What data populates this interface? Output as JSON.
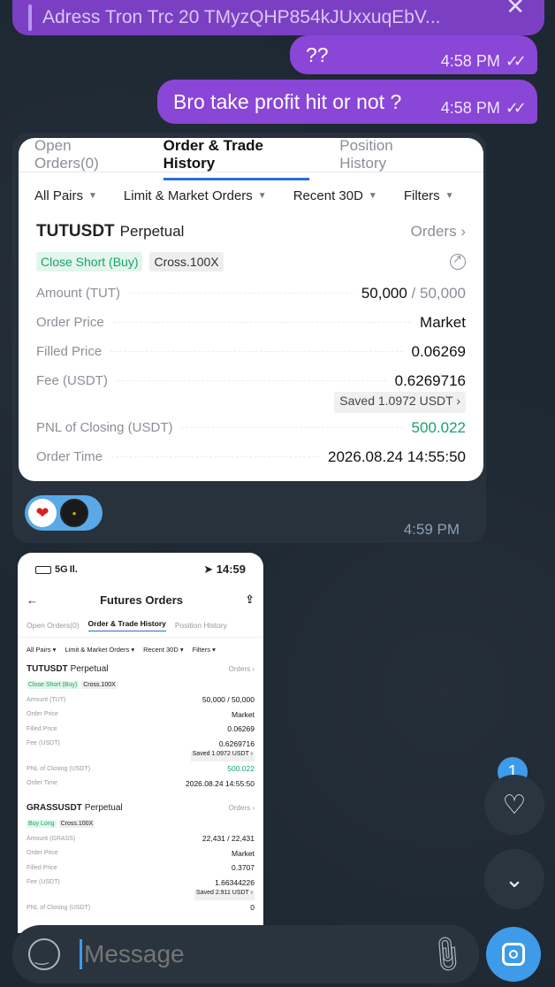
{
  "reply_preview": {
    "text": "Adress Tron Trc 20  TMyzQHP854kJUxxuqEbV...",
    "close": "✕"
  },
  "outgoing": [
    {
      "text": "??",
      "time": "4:58 PM"
    },
    {
      "text": "Bro take profit hit or not ?",
      "time": "4:58 PM"
    }
  ],
  "card": {
    "tabs": [
      "Open Orders(0)",
      "Order & Trade History",
      "Position History"
    ],
    "filters": [
      "All Pairs",
      "Limit & Market Orders",
      "Recent 30D",
      "Filters"
    ],
    "pair": "TUTUSDT",
    "pair_type": "Perpetual",
    "orders_link": "Orders",
    "badge_side": "Close Short (Buy)",
    "badge_margin": "Cross.100X",
    "rows": [
      {
        "label": "Amount (TUT)",
        "value": "50,000",
        "value2": " / 50,000"
      },
      {
        "label": "Order Price",
        "value": "Market"
      },
      {
        "label": "Filled Price",
        "value": "0.06269"
      },
      {
        "label": "Fee (USDT)",
        "value": "0.6269716"
      }
    ],
    "saved": "Saved 1.0972 USDT ›",
    "pnl_label": "PNL of Closing (USDT)",
    "pnl_value": "500.022",
    "time_label": "Order Time",
    "time_value": "2026.08.24 14:55:50"
  },
  "incoming_time": "4:59 PM",
  "shot": {
    "signal": "5G",
    "clock": "14:59",
    "title": "Futures Orders",
    "tabs": [
      "Open Orders(0)",
      "Order & Trade History",
      "Position History"
    ],
    "filters": [
      "All Pairs ▾",
      "Limit & Market Orders ▾",
      "Recent 30D ▾",
      "Filters ▾"
    ],
    "order1": {
      "pair": "TUTUSDT",
      "type": "Perpetual",
      "link": "Orders ›",
      "side": "Close Short (Buy)",
      "margin": "Cross.100X",
      "rows": [
        [
          "Amount (TUT)",
          "50,000 / 50,000"
        ],
        [
          "Order Price",
          "Market"
        ],
        [
          "Filled Price",
          "0.06269"
        ],
        [
          "Fee (USDT)",
          "0.6269716"
        ]
      ],
      "saved": "Saved 1.0972 USDT ›",
      "pnl": [
        "PNL of Closing (USDT)",
        "500.022"
      ],
      "time": [
        "Order Time",
        "2026.08.24 14:55:50"
      ]
    },
    "order2": {
      "pair": "GRASSUSDT",
      "type": "Perpetual",
      "link": "Orders ›",
      "side": "Buy Long",
      "margin": "Cross.100X",
      "rows": [
        [
          "Amount (GRASS)",
          "22,431 / 22,431"
        ],
        [
          "Order Price",
          "Market"
        ],
        [
          "Filled Price",
          "0.3707"
        ],
        [
          "Fee (USDT)",
          "1.66344226"
        ]
      ],
      "saved": "Saved 2.911 USDT ›",
      "pnl": [
        "PNL of Closing (USDT)",
        "0"
      ]
    }
  },
  "unread_count": "1",
  "input_placeholder": "Message",
  "colors": {
    "accent": "#3d9be9",
    "outgoing_bubble": "#8a46d6",
    "profit_green": "#16a36a"
  }
}
